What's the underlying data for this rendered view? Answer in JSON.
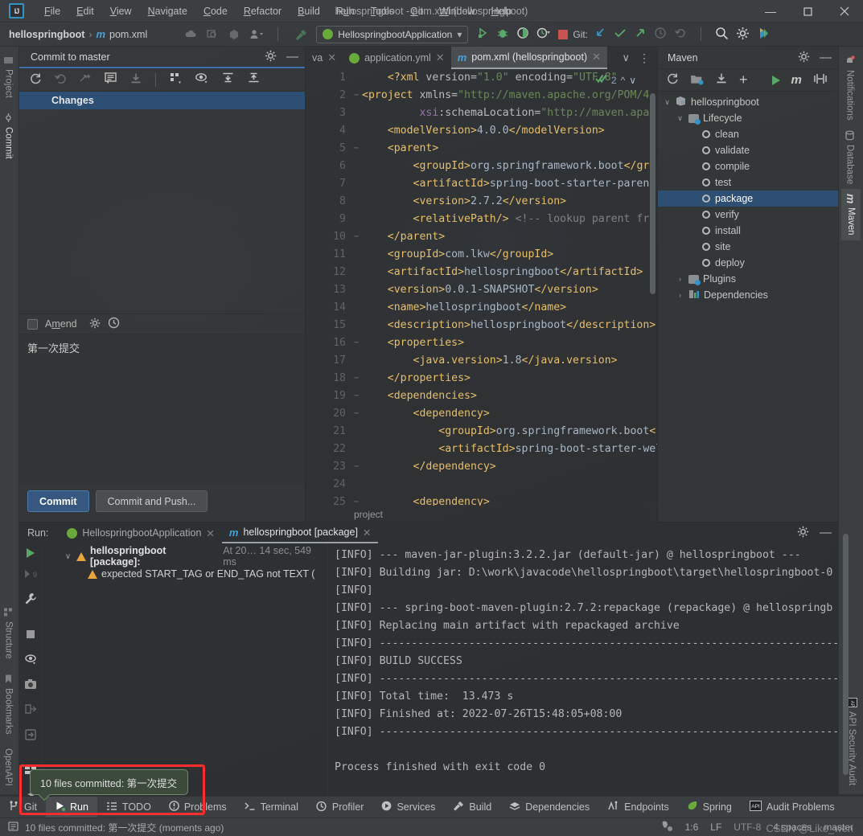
{
  "window": {
    "title": "hellospringboot - pom.xml (hellospringboot)",
    "logo": "IJ",
    "minimize": "—",
    "maximize": "☐",
    "close": "✕"
  },
  "menu": [
    "File",
    "Edit",
    "View",
    "Navigate",
    "Code",
    "Refactor",
    "Build",
    "Run",
    "Tools",
    "Git",
    "Window",
    "Help"
  ],
  "navbar": {
    "project": "hellospringboot",
    "separator": "›",
    "file_badge": "m",
    "file": "pom.xml",
    "run_config": "HellospringbootApplication",
    "run_config_arrow": "▾",
    "git_label": "Git:",
    "icons": [
      "cloud-icon",
      "search-everywhere-icon",
      "hexagon-icon",
      "account-icon"
    ],
    "run_icons": [
      "run-icon",
      "debug-icon",
      "coverage-icon",
      "profiler-icon",
      "stop-icon"
    ],
    "git_icons": [
      "update-project-icon",
      "commit-icon",
      "push-icon",
      "history-icon",
      "rollback-icon"
    ],
    "right_icons": [
      "search-icon",
      "settings-icon",
      "ide-feature-icon"
    ]
  },
  "left_strip": {
    "top": [
      "Project",
      "Commit"
    ],
    "bottom": [
      "Structure",
      "Bookmarks",
      "OpenAPI"
    ]
  },
  "right_strip": {
    "top": [
      "Notifications",
      "Database",
      "Maven"
    ],
    "bottom": [
      "API Security Audit"
    ]
  },
  "commit": {
    "title": "Commit to master",
    "toolbar_icons": [
      "refresh-icon",
      "rollback-icon",
      "shelve-icon",
      "diff-icon",
      "download-icon",
      "group-by-icon",
      "preview-icon",
      "expand-all-icon",
      "collapse-all-icon"
    ],
    "changes_label": "Changes",
    "amend_label": "Amend",
    "amend_checked": false,
    "message": "第一次提交",
    "commit_button": "Commit",
    "commit_push_button": "Commit and Push..."
  },
  "editor": {
    "tabs": [
      {
        "label": "va",
        "icon": "java-icon",
        "active": false,
        "closable": true
      },
      {
        "label": "application.yml",
        "icon": "spring-icon",
        "active": false,
        "closable": true
      },
      {
        "label": "pom.xml (hellospringboot)",
        "icon": "maven-icon",
        "active": true,
        "closable": true
      }
    ],
    "inspection_count": "2",
    "inspection_icon": "inspection-ok-icon",
    "breadcrumb": "project",
    "lines": [
      {
        "n": "1",
        "fold": "",
        "html": "<span class='k-plain'>    </span><span class='k-tag'>&lt;?xml </span><span class='k-attr'>version=</span><span class='k-str'>\"1.0\"</span><span class='k-attr'> encoding=</span><span class='k-str'>\"UTF-8\"</span>"
      },
      {
        "n": "2",
        "fold": "−",
        "html": "<span class='k-tag'>&lt;project </span><span class='k-attr'>xmlns=</span><span class='k-str'>\"http://maven.apache.org/POM/4.</span>"
      },
      {
        "n": "3",
        "fold": "",
        "html": "<span class='k-plain'>         </span><span class='k-ns'>xsi</span><span class='k-attr'>:schemaLocation=</span><span class='k-str'>\"http://maven.apac</span>"
      },
      {
        "n": "4",
        "fold": "",
        "html": "<span class='k-plain'>    </span><span class='k-tag'>&lt;modelVersion&gt;</span><span class='k-val'>4.0.0</span><span class='k-tag'>&lt;/modelVersion&gt;</span>"
      },
      {
        "n": "5",
        "fold": "−",
        "html": "<span class='k-plain'>    </span><span class='k-tag'>&lt;parent&gt;</span>"
      },
      {
        "n": "6",
        "fold": "",
        "html": "<span class='k-plain'>        </span><span class='k-tag'>&lt;groupId&gt;</span><span class='k-val'>org.springframework.boot</span><span class='k-tag'>&lt;/gro</span>"
      },
      {
        "n": "7",
        "fold": "",
        "html": "<span class='k-plain'>        </span><span class='k-tag'>&lt;artifactId&gt;</span><span class='k-val'>spring-boot-starter-parent</span>"
      },
      {
        "n": "8",
        "fold": "",
        "html": "<span class='k-plain'>        </span><span class='k-tag'>&lt;version&gt;</span><span class='k-val'>2.7.2</span><span class='k-tag'>&lt;/version&gt;</span>"
      },
      {
        "n": "9",
        "fold": "",
        "html": "<span class='k-plain'>        </span><span class='k-tag'>&lt;relativePath/&gt;</span><span class='k-com'> &lt;!-- lookup parent fro</span>"
      },
      {
        "n": "10",
        "fold": "−",
        "html": "<span class='k-plain'>    </span><span class='k-tag'>&lt;/parent&gt;</span>"
      },
      {
        "n": "11",
        "fold": "",
        "html": "<span class='k-plain'>    </span><span class='k-tag'>&lt;groupId&gt;</span><span class='k-val'>com.lkw</span><span class='k-tag'>&lt;/groupId&gt;</span>"
      },
      {
        "n": "12",
        "fold": "",
        "html": "<span class='k-plain'>    </span><span class='k-tag'>&lt;artifactId&gt;</span><span class='k-val'>hellospringboot</span><span class='k-tag'>&lt;/artifactId&gt;</span>"
      },
      {
        "n": "13",
        "fold": "",
        "html": "<span class='k-plain'>    </span><span class='k-tag'>&lt;version&gt;</span><span class='k-val'>0.0.1-SNAPSHOT</span><span class='k-tag'>&lt;/version&gt;</span>"
      },
      {
        "n": "14",
        "fold": "",
        "html": "<span class='k-plain'>    </span><span class='k-tag'>&lt;name&gt;</span><span class='k-val'>hellospringboot</span><span class='k-tag'>&lt;/name&gt;</span>"
      },
      {
        "n": "15",
        "fold": "",
        "html": "<span class='k-plain'>    </span><span class='k-tag'>&lt;description&gt;</span><span class='k-val'>hellospringboot</span><span class='k-tag'>&lt;/description&gt;</span>"
      },
      {
        "n": "16",
        "fold": "−",
        "html": "<span class='k-plain'>    </span><span class='k-tag'>&lt;properties&gt;</span>"
      },
      {
        "n": "17",
        "fold": "",
        "html": "<span class='k-plain'>        </span><span class='k-tag'>&lt;java.version&gt;</span><span class='k-val'>1.8</span><span class='k-tag'>&lt;/java.version&gt;</span>"
      },
      {
        "n": "18",
        "fold": "−",
        "html": "<span class='k-plain'>    </span><span class='k-tag'>&lt;/properties&gt;</span>"
      },
      {
        "n": "19",
        "fold": "−",
        "html": "<span class='k-plain'>    </span><span class='k-tag'>&lt;dependencies&gt;</span>"
      },
      {
        "n": "20",
        "fold": "−",
        "html": "<span class='k-plain'>        </span><span class='k-tag'>&lt;dependency&gt;</span>"
      },
      {
        "n": "21",
        "fold": "",
        "html": "<span class='k-plain'>            </span><span class='k-tag'>&lt;groupId&gt;</span><span class='k-val'>org.springframework.boot</span><span class='k-tag'>&lt;</span>"
      },
      {
        "n": "22",
        "fold": "",
        "html": "<span class='k-plain'>            </span><span class='k-tag'>&lt;artifactId&gt;</span><span class='k-val'>spring-boot-starter-wel</span>"
      },
      {
        "n": "23",
        "fold": "−",
        "html": "<span class='k-plain'>        </span><span class='k-tag'>&lt;/dependency&gt;</span>"
      },
      {
        "n": "24",
        "fold": "",
        "html": ""
      },
      {
        "n": "25",
        "fold": "−",
        "html": "<span class='k-plain'>        </span><span class='k-tag'>&lt;dependency&gt;</span>"
      }
    ]
  },
  "maven": {
    "title": "Maven",
    "toolbar_icons": [
      "reload-icon",
      "add-module-icon",
      "download-sources-icon",
      "add-icon",
      "run-icon",
      "maven-m-icon",
      "toggle-offline-icon",
      "more-icon"
    ],
    "tree": [
      {
        "label": "hellospringboot",
        "depth": 0,
        "twisty": "∨",
        "icon": "maven-project-icon",
        "selected": false
      },
      {
        "label": "Lifecycle",
        "depth": 1,
        "twisty": "∨",
        "icon": "maven-folder-icon",
        "selected": false
      },
      {
        "label": "clean",
        "depth": 2,
        "twisty": "",
        "icon": "gear-icon",
        "selected": false
      },
      {
        "label": "validate",
        "depth": 2,
        "twisty": "",
        "icon": "gear-icon",
        "selected": false
      },
      {
        "label": "compile",
        "depth": 2,
        "twisty": "",
        "icon": "gear-icon",
        "selected": false
      },
      {
        "label": "test",
        "depth": 2,
        "twisty": "",
        "icon": "gear-icon",
        "selected": false
      },
      {
        "label": "package",
        "depth": 2,
        "twisty": "",
        "icon": "gear-icon",
        "selected": true
      },
      {
        "label": "verify",
        "depth": 2,
        "twisty": "",
        "icon": "gear-icon",
        "selected": false
      },
      {
        "label": "install",
        "depth": 2,
        "twisty": "",
        "icon": "gear-icon",
        "selected": false
      },
      {
        "label": "site",
        "depth": 2,
        "twisty": "",
        "icon": "gear-icon",
        "selected": false
      },
      {
        "label": "deploy",
        "depth": 2,
        "twisty": "",
        "icon": "gear-icon",
        "selected": false
      },
      {
        "label": "Plugins",
        "depth": 1,
        "twisty": "›",
        "icon": "maven-folder-icon",
        "selected": false
      },
      {
        "label": "Dependencies",
        "depth": 1,
        "twisty": "›",
        "icon": "dependencies-icon",
        "selected": false
      }
    ]
  },
  "run": {
    "label": "Run:",
    "tabs": [
      {
        "label": "HellospringbootApplication",
        "icon": "spring-icon",
        "active": false
      },
      {
        "label": "hellospringboot [package]",
        "icon": "maven-icon",
        "active": true
      }
    ],
    "side_icons": [
      "rerun-icon",
      "rerun-failed-icon",
      "settings-wrench-icon",
      "stop-icon",
      "eye-filter-icon",
      "screenshot-icon",
      "export-icon",
      "import-icon",
      "layout-icon",
      "pin-icon"
    ],
    "tree": {
      "root_name": "hellospringboot [package]:",
      "root_meta": "At 20… 14 sec, 549 ms",
      "child": "expected START_TAG or END_TAG not TEXT ("
    },
    "console": [
      "[INFO] --- maven-jar-plugin:3.2.2.jar (default-jar) @ hellospringboot ---",
      "[INFO] Building jar: D:\\work\\javacode\\hellospringboot\\target\\hellospringboot-0",
      "[INFO]",
      "[INFO] --- spring-boot-maven-plugin:2.7.2:repackage (repackage) @ hellospringb",
      "[INFO] Replacing main artifact with repackaged archive",
      "[INFO] ------------------------------------------------------------------------",
      "[INFO] BUILD SUCCESS",
      "[INFO] ------------------------------------------------------------------------",
      "[INFO] Total time:  13.473 s",
      "[INFO] Finished at: 2022-07-26T15:48:05+08:00",
      "[INFO] ------------------------------------------------------------------------",
      "",
      "Process finished with exit code 0"
    ]
  },
  "bottom_bar": [
    {
      "label": "Git",
      "icon": "git-branch-icon",
      "active": false
    },
    {
      "label": "Run",
      "icon": "run-icon",
      "active": true
    },
    {
      "label": "TODO",
      "icon": "todo-icon",
      "active": false
    },
    {
      "label": "Problems",
      "icon": "problems-icon",
      "active": false
    },
    {
      "label": "Terminal",
      "icon": "terminal-icon",
      "active": false
    },
    {
      "label": "Profiler",
      "icon": "profiler-icon",
      "active": false
    },
    {
      "label": "Services",
      "icon": "services-icon",
      "active": false
    },
    {
      "label": "Build",
      "icon": "build-hammer-icon",
      "active": false
    },
    {
      "label": "Dependencies",
      "icon": "dependencies-icon",
      "active": false
    },
    {
      "label": "Endpoints",
      "icon": "endpoints-icon",
      "active": false
    },
    {
      "label": "Spring",
      "icon": "spring-leaf-icon",
      "active": false
    },
    {
      "label": "Audit Problems",
      "icon": "api-audit-icon",
      "active": false
    }
  ],
  "statusbar": {
    "message": "10 files committed: 第一次提交 (moments ago)",
    "caret": "1:6",
    "line_sep": "LF",
    "encoding": "UTF-8",
    "indent": "4 spaces",
    "branch": "master",
    "icons": [
      "event-log-icon",
      "inspections-icon"
    ]
  },
  "notification": {
    "text": "10 files committed: 第一次提交"
  },
  "watermark": "CSDN @Like_wen",
  "colors": {
    "accent_blue": "#3592c4",
    "selection_blue": "#2d4f74",
    "button_blue": "#365880",
    "green": "#59a869",
    "red": "#c75450",
    "warn_orange": "#e8a33d",
    "highlight_red": "#ff2d2d"
  }
}
